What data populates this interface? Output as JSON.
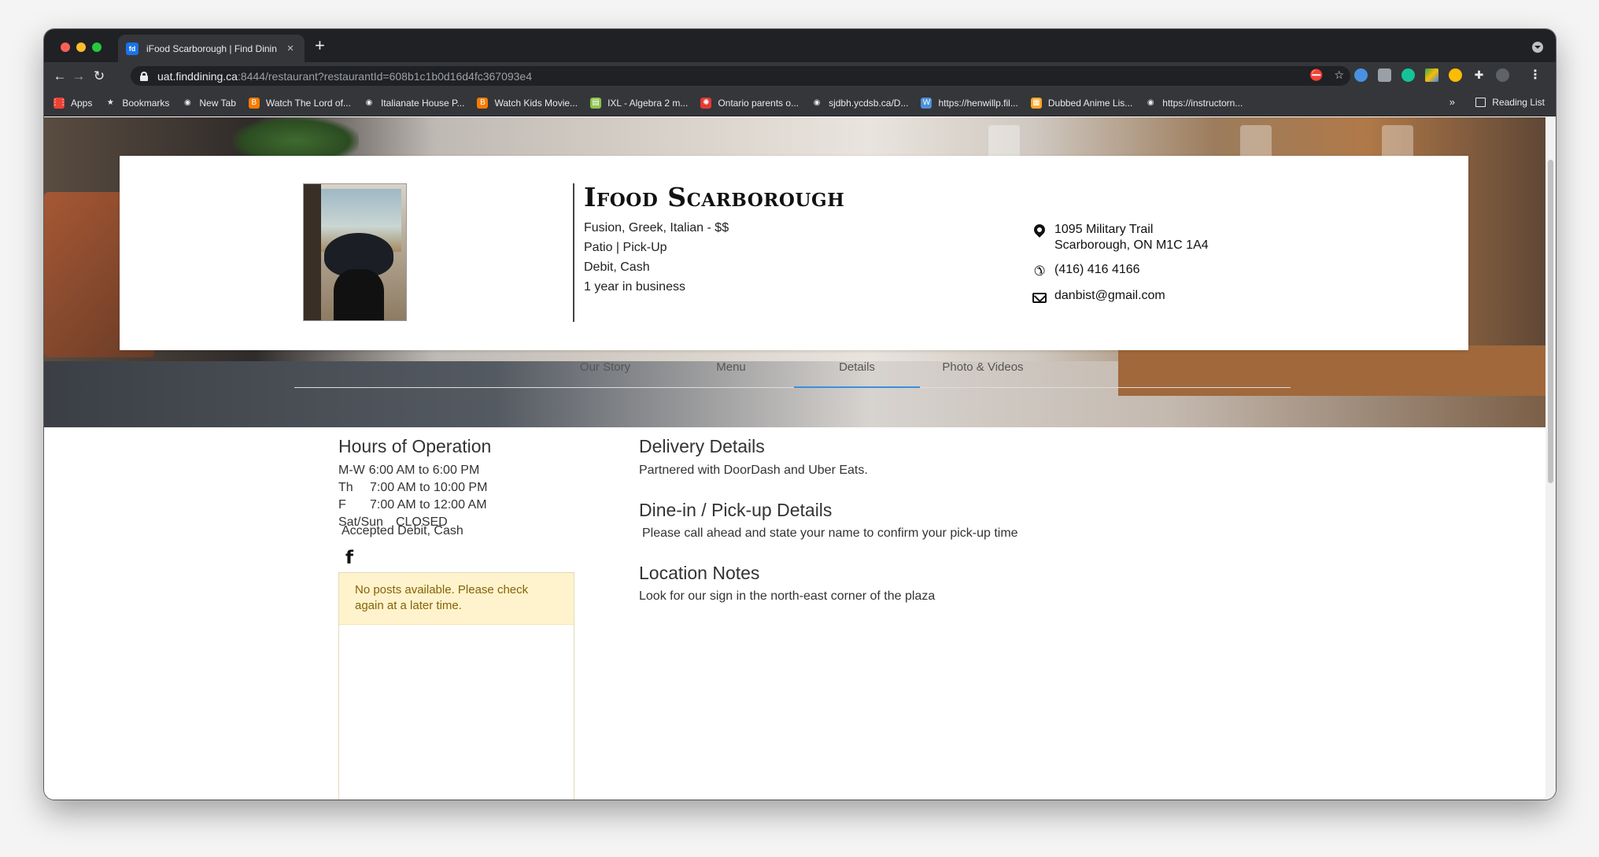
{
  "browser": {
    "tab_title": "iFood Scarborough | Find Dinin",
    "tab_close": "×",
    "new_tab": "+",
    "url_host": "uat.finddining.ca",
    "url_rest": ":8444/restaurant?restaurantId=608b1c1b0d16d4fc367093e4",
    "bookmarks": [
      {
        "label": "Apps",
        "icon": "apps-grid-icon",
        "color": "#ea4335"
      },
      {
        "label": "Bookmarks",
        "icon": "star-icon",
        "color": "#e8eaed"
      },
      {
        "label": "New Tab",
        "icon": "globe-icon",
        "color": "#e8eaed"
      },
      {
        "label": "Watch The Lord of...",
        "icon": "blogger-icon",
        "color": "#f57c00"
      },
      {
        "label": "Italianate House P...",
        "icon": "globe-icon",
        "color": "#e8eaed"
      },
      {
        "label": "Watch Kids Movie...",
        "icon": "blogger-icon",
        "color": "#f57c00"
      },
      {
        "label": "IXL - Algebra 2 m...",
        "icon": "ixl-icon",
        "color": "#8bc34a"
      },
      {
        "label": "Ontario parents o...",
        "icon": "cbc-icon",
        "color": "#e53935"
      },
      {
        "label": "sjdbh.ycdsb.ca/D...",
        "icon": "globe-icon",
        "color": "#e8eaed"
      },
      {
        "label": "https://henwillp.fil...",
        "icon": "wordpress-icon",
        "color": "#4a90d9"
      },
      {
        "label": "Dubbed Anime Lis...",
        "icon": "folder-icon",
        "color": "#f9a825"
      },
      {
        "label": "https://instructorn...",
        "icon": "globe-icon",
        "color": "#e8eaed"
      }
    ],
    "bookmarks_more": "»",
    "reading_list": "Reading List"
  },
  "restaurant": {
    "name": "Ifood Scarborough",
    "cuisine": "Fusion, Greek, Italian - $$",
    "services": "Patio | Pick-Up",
    "payment": "Debit, Cash",
    "years": "1 year in business",
    "address_line1": "1095 Military Trail",
    "address_line2": "Scarborough, ON M1C 1A4",
    "phone": "(416) 416 4166",
    "email": "danbist@gmail.com"
  },
  "tabs": [
    {
      "label": "Our Story",
      "active": false
    },
    {
      "label": "Menu",
      "active": false
    },
    {
      "label": "Details",
      "active": true
    },
    {
      "label": "Photo & Videos",
      "active": false
    }
  ],
  "hours": {
    "title": "Hours of Operation",
    "rows": [
      {
        "day": "M-W",
        "time": "6:00 AM to 6:00 PM"
      },
      {
        "day": "Th",
        "time": "7:00 AM to 10:00 PM"
      },
      {
        "day": "F",
        "time": "7:00 AM to 12:00 AM"
      },
      {
        "day": "Sat/Sun",
        "time": "CLOSED"
      }
    ],
    "accepted": "Accepted Debit, Cash",
    "facebook_glyph": "f",
    "posts_alert": "No posts available. Please check again at a later time."
  },
  "details": {
    "delivery_title": "Delivery Details",
    "delivery_text": "Partnered with DoorDash and Uber Eats.",
    "dinein_title": "Dine-in / Pick-up Details",
    "dinein_text": "Please call ahead and state your name to confirm your pick-up time",
    "location_title": "Location Notes",
    "location_text": "Look for our sign in the north-east corner of the plaza"
  },
  "colors": {
    "tab_active_underline": "#3b8fd9",
    "alert_bg": "#fff3cd",
    "alert_text": "#856404"
  }
}
